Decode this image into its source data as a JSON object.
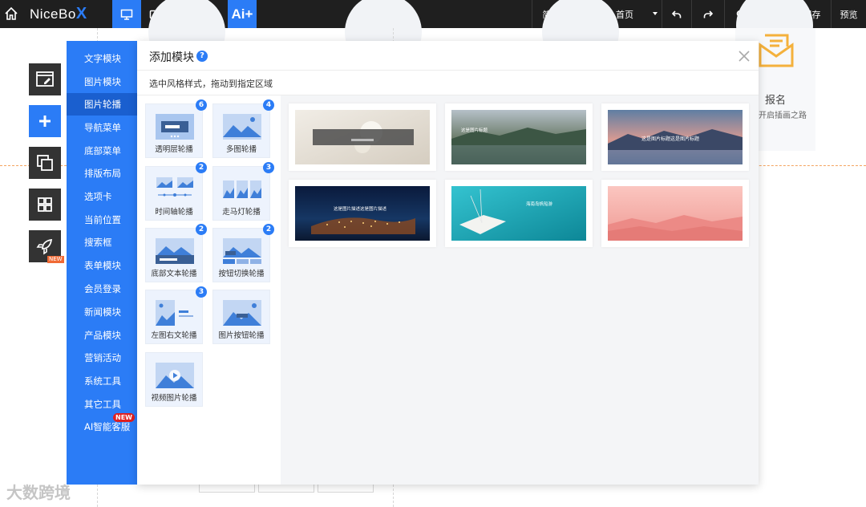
{
  "topbar": {
    "logo_main": "NiceBo",
    "logo_x": "X",
    "ai_label": "Ai+",
    "language": "简体中文",
    "page": "首页",
    "save": "保存",
    "preview": "预览"
  },
  "background": {
    "signup_title": "报名",
    "signup_subtitle": "开启插画之路"
  },
  "sidebar": {
    "items": [
      {
        "label": "文字模块"
      },
      {
        "label": "图片模块"
      },
      {
        "label": "图片轮播"
      },
      {
        "label": "导航菜单"
      },
      {
        "label": "底部菜单"
      },
      {
        "label": "排版布局"
      },
      {
        "label": "选项卡"
      },
      {
        "label": "当前位置"
      },
      {
        "label": "搜索框"
      },
      {
        "label": "表单模块"
      },
      {
        "label": "会员登录"
      },
      {
        "label": "新闻模块"
      },
      {
        "label": "产品模块"
      },
      {
        "label": "营销活动"
      },
      {
        "label": "系统工具"
      },
      {
        "label": "其它工具"
      },
      {
        "label": "AI智能客服"
      }
    ],
    "active_index": 2,
    "new_badge": "NEW"
  },
  "left_tools": {
    "new_badge": "NEW"
  },
  "panel": {
    "title": "添加模块",
    "help": "?",
    "hint": "选中风格样式，拖动到指定区域",
    "styles": [
      {
        "label": "透明层轮播",
        "count": "6"
      },
      {
        "label": "多图轮播",
        "count": "4"
      },
      {
        "label": "时间轴轮播",
        "count": "2"
      },
      {
        "label": "走马灯轮播",
        "count": "3"
      },
      {
        "label": "底部文本轮播",
        "count": "2"
      },
      {
        "label": "按钮切换轮播",
        "count": "2"
      },
      {
        "label": "左图右文轮播",
        "count": "3"
      },
      {
        "label": "图片按钮轮播",
        "count": ""
      },
      {
        "label": "视频图片轮播",
        "count": ""
      }
    ],
    "previews": [
      {
        "caption": "",
        "colors": [
          "#e8e2d8",
          "#cfc6b6"
        ]
      },
      {
        "caption": "这是图片标题",
        "colors": [
          "#8a9aa6",
          "#3e5a4a"
        ]
      },
      {
        "caption": "这是图片标题这是图片标题",
        "colors": [
          "#6d87a8",
          "#c98a86"
        ]
      },
      {
        "caption": "这是图片描述这是图片描述",
        "colors": [
          "#0c1a3a",
          "#6a3a20"
        ]
      },
      {
        "caption": "海南岛帆船游",
        "colors": [
          "#2cb6c4",
          "#0e8a9a"
        ]
      },
      {
        "caption": "",
        "colors": [
          "#f9b8b4",
          "#ec8a86"
        ]
      }
    ]
  },
  "watermark": "大数跨境",
  "colors": {
    "accent": "#2b7cf6",
    "topbar": "#1f1f1f",
    "sidebar_active": "#1a5fcf"
  }
}
